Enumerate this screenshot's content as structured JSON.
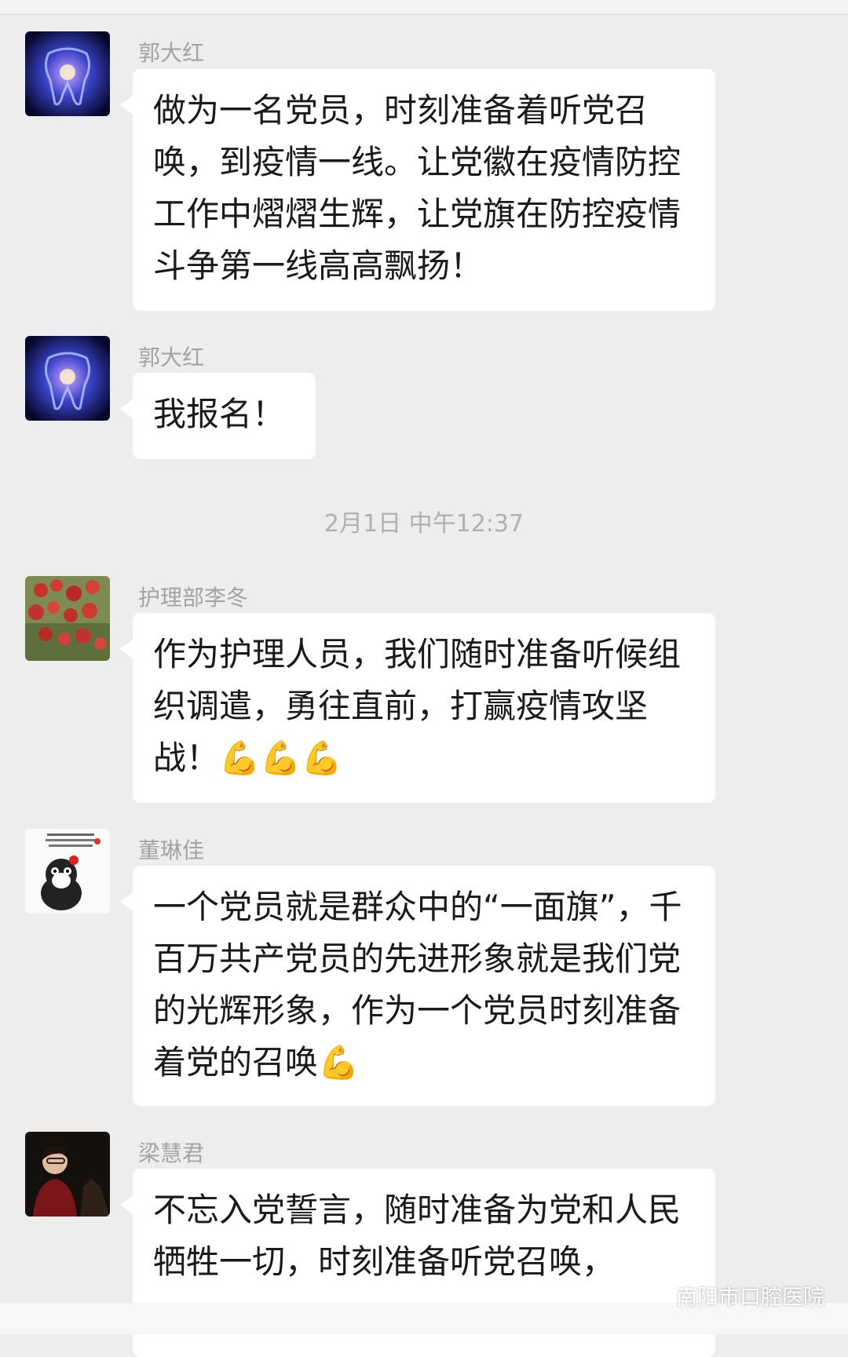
{
  "timestamp": "2月1日 中午12:37",
  "messages": [
    {
      "sender": "郭大红",
      "text": "做为一名党员，时刻准备着听党召唤，到疫情一线。让党徽在疫情防控工作中熠熠生辉，让党旗在防控疫情斗争第一线高高飘扬！",
      "emoji": ""
    },
    {
      "sender": "郭大红",
      "text": "我报名！",
      "emoji": ""
    },
    {
      "sender": "护理部李冬",
      "text": "作为护理人员，我们随时准备听候组织调遣，勇往直前，打赢疫情攻坚战！",
      "emoji": "💪💪💪"
    },
    {
      "sender": "董琳佳",
      "text": "一个党员就是群众中的“一面旗”，千百万共产党员的先进形象就是我们党的光辉形象，作为一个党员时刻准备着党的召唤",
      "emoji": "💪"
    },
    {
      "sender": "梁慧君",
      "text": "不忘入党誓言，随时准备为党和人民牺牲一切，时刻准备听党召唤，",
      "emoji": ""
    }
  ],
  "watermark": "南阳市口腔医院",
  "icons": {
    "watermark_icon": "wechat-logo-icon"
  }
}
